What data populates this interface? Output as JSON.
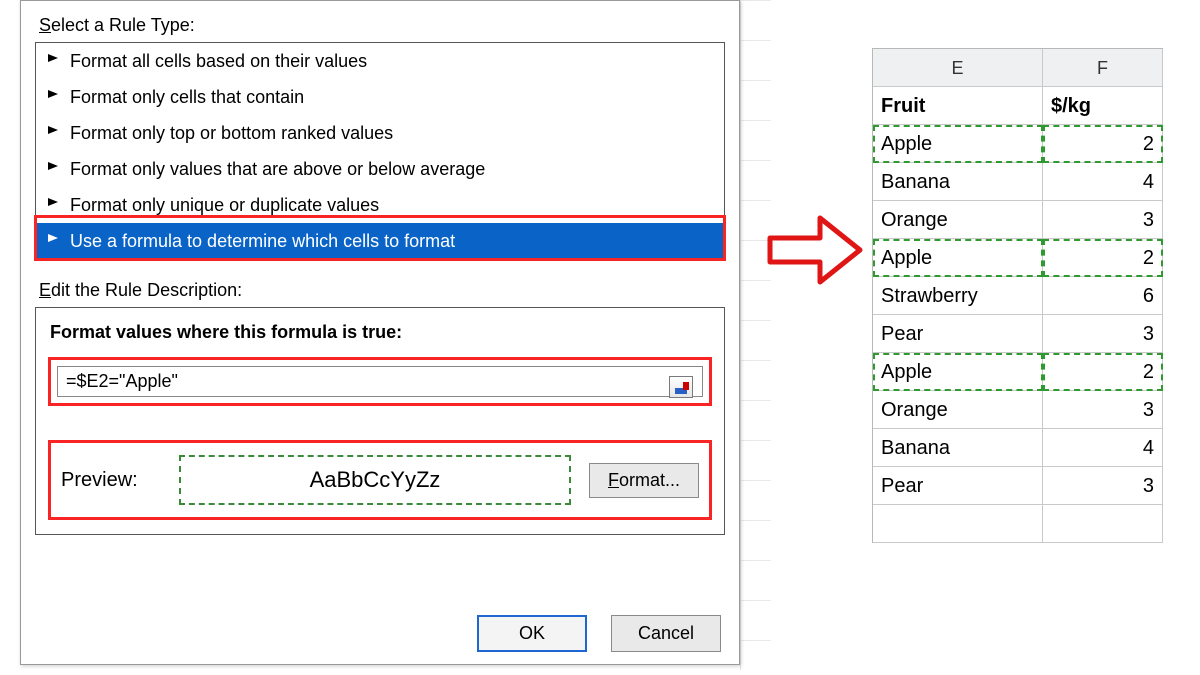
{
  "dialog": {
    "select_label_pre": "S",
    "select_label_rest": "elect a Rule Type:",
    "rules": [
      "Format all cells based on their values",
      "Format only cells that contain",
      "Format only top or bottom ranked values",
      "Format only values that are above or below average",
      "Format only unique or duplicate values",
      "Use a formula to determine which cells to format"
    ],
    "edit_label_pre": "E",
    "edit_label_rest": "dit the Rule Description:",
    "format_values_pre": "F",
    "format_values_mid": "o",
    "format_values_rest": "rmat values where this formula is true:",
    "formula_value": "=$E2=\"Apple\"",
    "preview_label": "Preview:",
    "preview_sample": "AaBbCcYyZz",
    "format_btn_pre": "F",
    "format_btn_rest": "ormat...",
    "ok": "OK",
    "cancel": "Cancel"
  },
  "sheet": {
    "col_headers": [
      "E",
      "F"
    ],
    "label_row": [
      "Fruit",
      "$/kg"
    ],
    "rows": [
      {
        "fruit": "Apple",
        "price": "2",
        "hl": true
      },
      {
        "fruit": "Banana",
        "price": "4",
        "hl": false
      },
      {
        "fruit": "Orange",
        "price": "3",
        "hl": false
      },
      {
        "fruit": "Apple",
        "price": "2",
        "hl": true
      },
      {
        "fruit": "Strawberry",
        "price": "6",
        "hl": false
      },
      {
        "fruit": "Pear",
        "price": "3",
        "hl": false
      },
      {
        "fruit": "Apple",
        "price": "2",
        "hl": true
      },
      {
        "fruit": "Orange",
        "price": "3",
        "hl": false
      },
      {
        "fruit": "Banana",
        "price": "4",
        "hl": false
      },
      {
        "fruit": "Pear",
        "price": "3",
        "hl": false
      }
    ]
  }
}
